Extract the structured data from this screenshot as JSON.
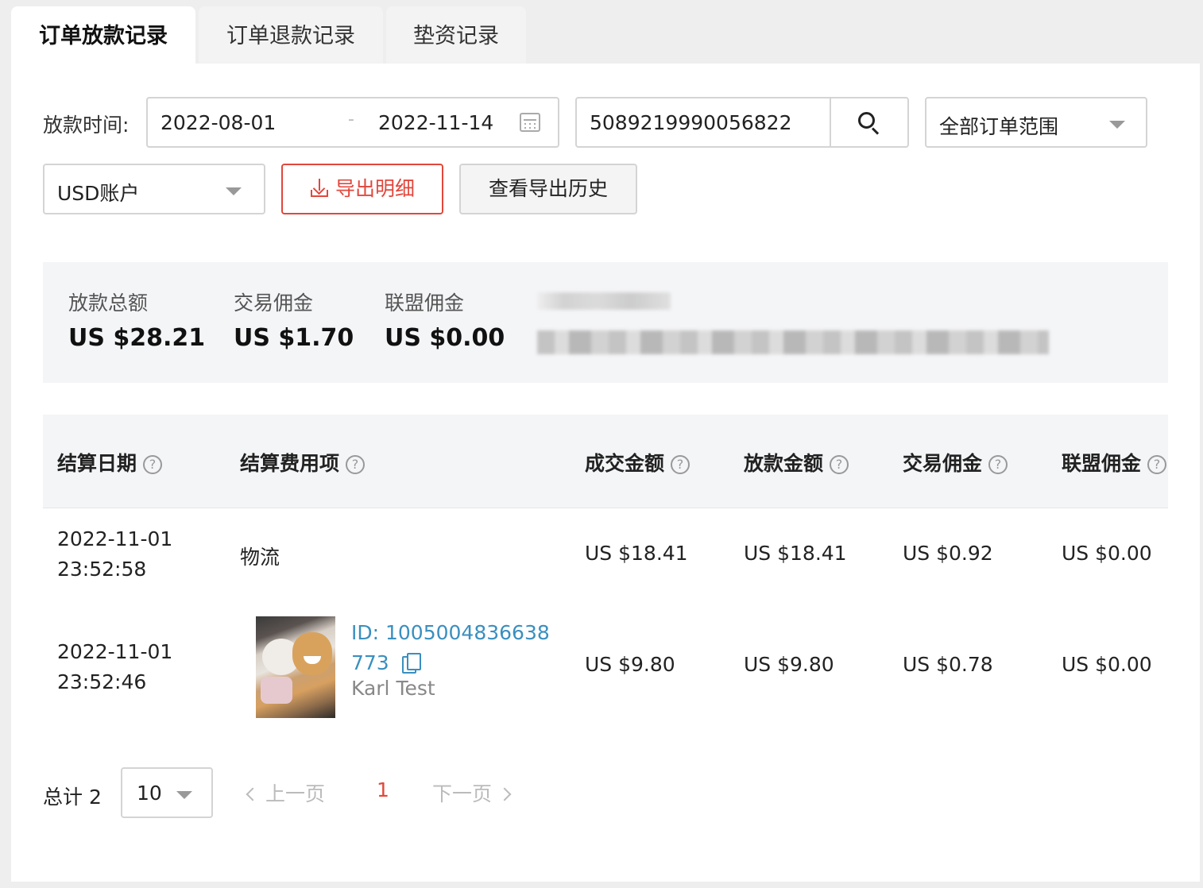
{
  "tabs": [
    {
      "label": "订单放款记录",
      "active": true
    },
    {
      "label": "订单退款记录",
      "active": false
    },
    {
      "label": "垫资记录",
      "active": false
    }
  ],
  "filters": {
    "time_label": "放款时间:",
    "date_start": "2022-08-01",
    "date_sep": "-",
    "date_end": "2022-11-14",
    "search_value": "5089219990056822",
    "scope_select": "全部订单范围",
    "account_select": "USD账户",
    "export_label": "导出明细",
    "history_label": "查看导出历史"
  },
  "summary": [
    {
      "label": "放款总额",
      "value": "US $28.21"
    },
    {
      "label": "交易佣金",
      "value": "US $1.70"
    },
    {
      "label": "联盟佣金",
      "value": "US $0.00"
    }
  ],
  "table": {
    "headers": [
      "结算日期",
      "结算费用项",
      "成交金额",
      "放款金额",
      "交易佣金",
      "联盟佣金"
    ],
    "help_symbol": "?",
    "rows": [
      {
        "date": "2022-11-01",
        "time": "23:52:58",
        "item": "物流",
        "deal": "US $18.41",
        "payout": "US $18.41",
        "trade_comm": "US $0.92",
        "affiliate_comm": "US $0.00"
      },
      {
        "date": "2022-11-01",
        "time": "23:52:46",
        "product_id_line1": "ID: 1005004836638",
        "product_id_line2": "773",
        "product_name": "Karl Test",
        "deal": "US $9.80",
        "payout": "US $9.80",
        "trade_comm": "US $0.78",
        "affiliate_comm": "US $0.00"
      }
    ]
  },
  "pagination": {
    "total": "总计 2",
    "page_size": "10",
    "prev": "上一页",
    "current": "1",
    "next": "下一页"
  },
  "colors": {
    "accent": "#e2473c",
    "link": "#3a8fbf"
  }
}
